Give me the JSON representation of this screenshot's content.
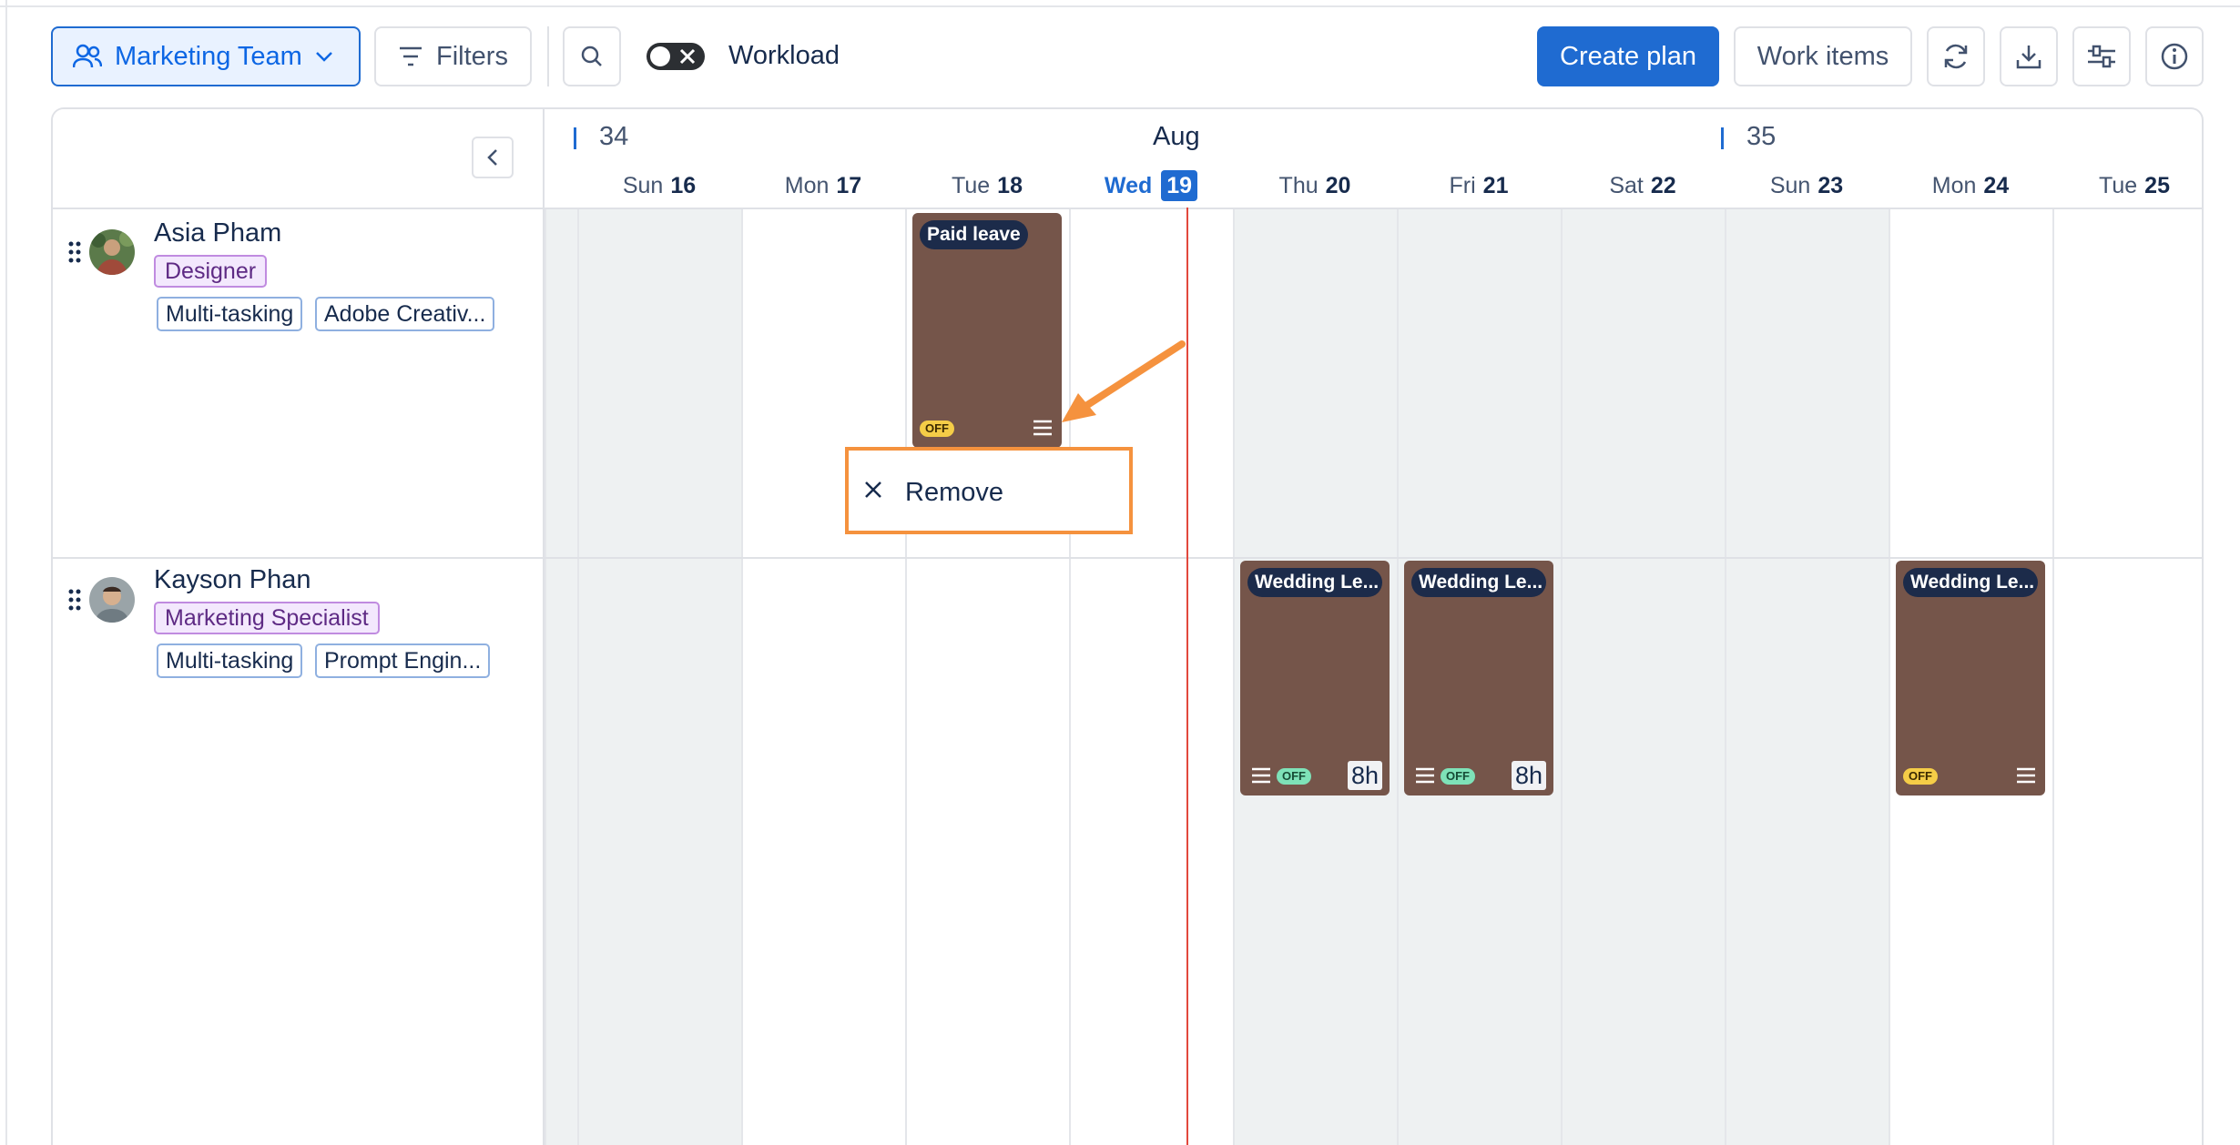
{
  "toolbar": {
    "team_label": "Marketing Team",
    "filters_label": "Filters",
    "workload_label": "Workload",
    "create_plan_label": "Create plan",
    "work_items_label": "Work items"
  },
  "timeline": {
    "month": "Aug",
    "weeks": [
      "34",
      "35"
    ],
    "days": [
      {
        "name": "Sun",
        "num": "16"
      },
      {
        "name": "Mon",
        "num": "17"
      },
      {
        "name": "Tue",
        "num": "18"
      },
      {
        "name": "Wed",
        "num": "19"
      },
      {
        "name": "Thu",
        "num": "20"
      },
      {
        "name": "Fri",
        "num": "21"
      },
      {
        "name": "Sat",
        "num": "22"
      },
      {
        "name": "Sun",
        "num": "23"
      },
      {
        "name": "Mon",
        "num": "24"
      },
      {
        "name": "Tue",
        "num": "25"
      }
    ]
  },
  "people": [
    {
      "name": "Asia Pham",
      "role": "Designer",
      "skills": [
        "Multi-tasking",
        "Adobe Creativ..."
      ],
      "leaves": [
        {
          "title": "Paid leave",
          "badge": "OFF"
        }
      ]
    },
    {
      "name": "Kayson Phan",
      "role": "Marketing Specialist",
      "skills": [
        "Multi-tasking",
        "Prompt Engin..."
      ],
      "leaves": [
        {
          "title": "Wedding Le...",
          "badge": "OFF",
          "hours": "8h"
        },
        {
          "title": "Wedding Le...",
          "badge": "OFF",
          "hours": "8h"
        },
        {
          "title": "Wedding Le...",
          "badge": "OFF"
        }
      ]
    }
  ],
  "context_menu": {
    "remove_label": "Remove"
  },
  "colors": {
    "accent": "#1f6bd1",
    "leave_block": "#75554a",
    "today_line": "#e2483d",
    "highlight": "#f5923e"
  }
}
